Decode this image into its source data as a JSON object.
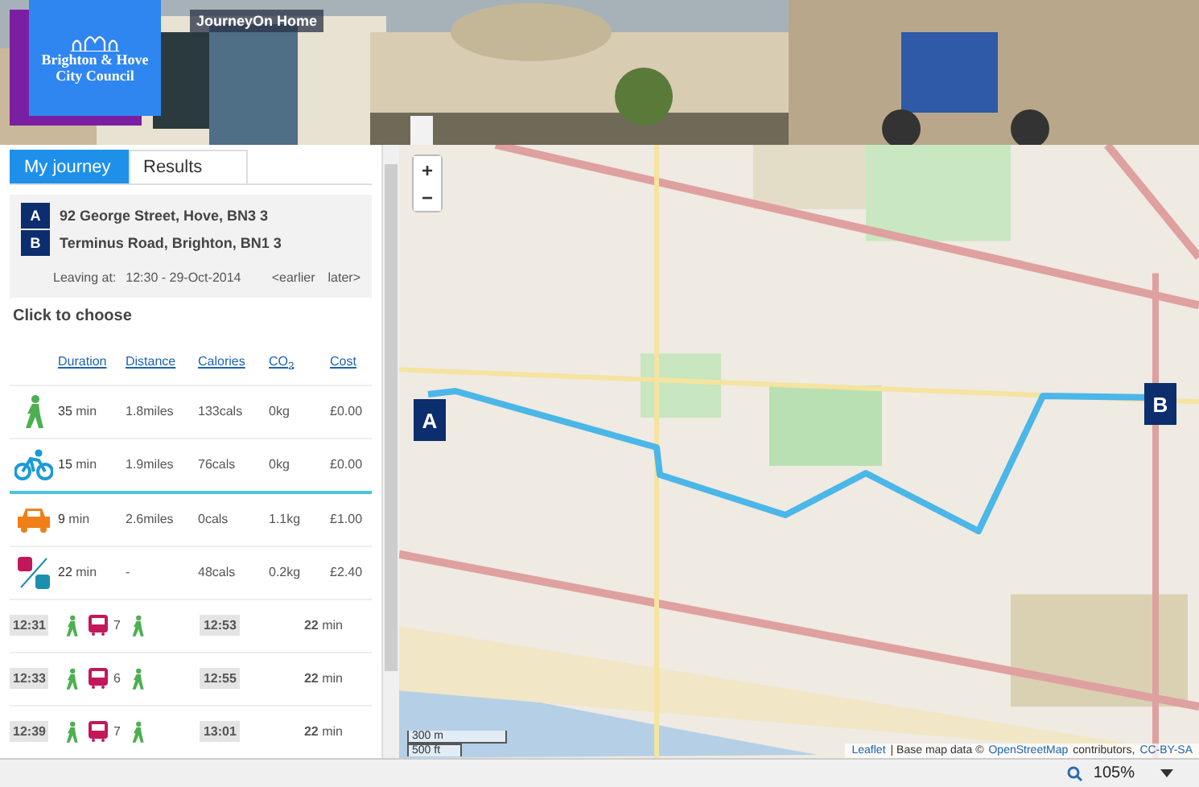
{
  "header": {
    "logo_lines": [
      "Brighton & Hove",
      "City Council"
    ],
    "home_link": "JourneyOn Home"
  },
  "tabs": [
    {
      "label": "My journey",
      "selected": true
    },
    {
      "label": "Results",
      "selected": false
    }
  ],
  "journey": {
    "from": {
      "letter": "A",
      "address": "92 George Street, Hove, BN3 3"
    },
    "to": {
      "letter": "B",
      "address": "Terminus Road, Brighton, BN1 3"
    },
    "leaving_label": "Leaving at:",
    "leaving_time": "12:30 - 29-Oct-2014",
    "earlier": "<earlier",
    "later": "later>"
  },
  "choose_title": "Click to choose",
  "columns": [
    "Duration",
    "Distance",
    "Calories",
    "CO$_{2}$",
    "Cost"
  ],
  "modes": [
    {
      "kind": "walk",
      "selected": false,
      "duration": "35",
      "unit": "min",
      "distance": "1.8miles",
      "calories": "133cals",
      "co2": "0kg",
      "cost": "£0.00"
    },
    {
      "kind": "bike",
      "selected": true,
      "duration": "15",
      "unit": "min",
      "distance": "1.9miles",
      "calories": "76cals",
      "co2": "0kg",
      "cost": "£0.00"
    },
    {
      "kind": "car",
      "selected": false,
      "duration": "9",
      "unit": "min",
      "distance": "2.6miles",
      "calories": "0cals",
      "co2": "1.1kg",
      "cost": "£1.00"
    },
    {
      "kind": "transit",
      "selected": false,
      "duration": "22",
      "unit": "min",
      "distance": "-",
      "calories": "48cals",
      "co2": "0.2kg",
      "cost": "£2.40"
    }
  ],
  "trips": [
    {
      "depart": "12:31",
      "legs": [
        {
          "kind": "walk"
        },
        {
          "kind": "bus",
          "route": "7"
        },
        {
          "kind": "walk"
        }
      ],
      "arrive": "12:53",
      "duration": "22",
      "unit": "min"
    },
    {
      "depart": "12:33",
      "legs": [
        {
          "kind": "walk"
        },
        {
          "kind": "bus",
          "route": "6"
        },
        {
          "kind": "walk"
        }
      ],
      "arrive": "12:55",
      "duration": "22",
      "unit": "min"
    },
    {
      "depart": "12:39",
      "legs": [
        {
          "kind": "walk"
        },
        {
          "kind": "bus",
          "route": "7"
        },
        {
          "kind": "walk"
        }
      ],
      "arrive": "13:01",
      "duration": "22",
      "unit": "min"
    }
  ],
  "map": {
    "zoom_in": "+",
    "zoom_out": "−",
    "marker_a": "A",
    "marker_b": "B",
    "scale_metric": "300 m",
    "scale_imperial": "500 ft",
    "attribution_leaflet": "Leaflet",
    "attribution_text": "| Base map data ©",
    "attribution_osm": "OpenStreetMap",
    "attribution_contrib": "contributors,",
    "attribution_license": "CC-BY-SA"
  },
  "status_bar": {
    "zoom": "105%"
  }
}
